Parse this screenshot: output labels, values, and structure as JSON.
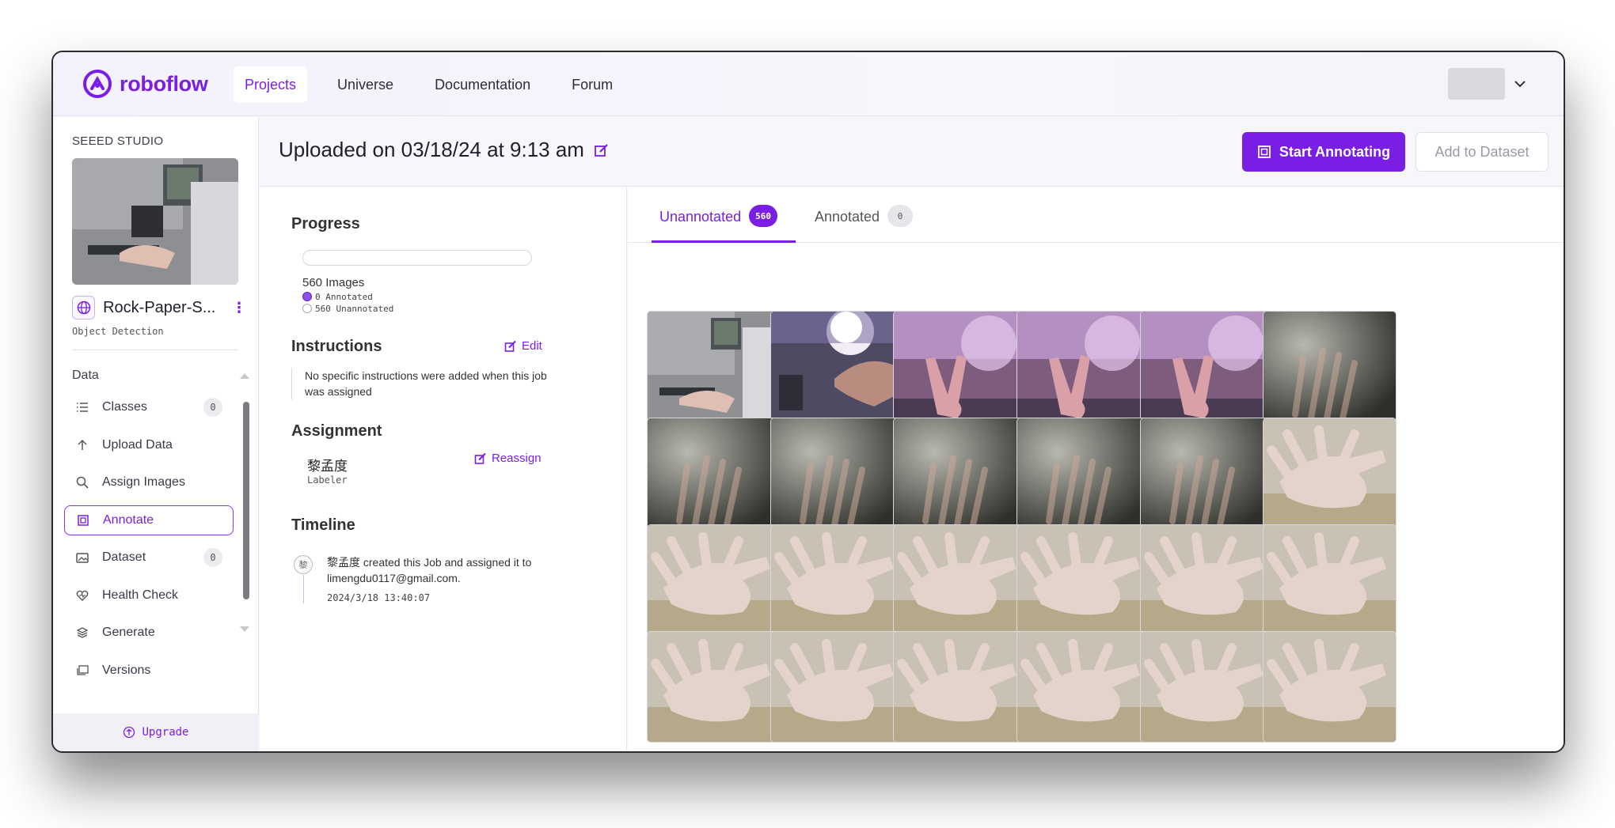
{
  "app": {
    "brand": "roboflow",
    "accent": "#7a1ee6"
  },
  "nav": {
    "items": [
      {
        "label": "Projects",
        "active": true
      },
      {
        "label": "Universe"
      },
      {
        "label": "Documentation"
      },
      {
        "label": "Forum"
      }
    ]
  },
  "sidebar": {
    "workspace": "SEEED STUDIO",
    "project_name": "Rock-Paper-S...",
    "project_type": "Object Detection",
    "section": "Data",
    "items": [
      {
        "label": "Classes",
        "icon": "list-icon",
        "badge": "0"
      },
      {
        "label": "Upload Data",
        "icon": "arrow-up-icon"
      },
      {
        "label": "Assign Images",
        "icon": "search-icon"
      },
      {
        "label": "Annotate",
        "icon": "annotate-icon",
        "active": true
      },
      {
        "label": "Dataset",
        "icon": "images-icon",
        "badge": "0"
      },
      {
        "label": "Health Check",
        "icon": "heart-icon"
      },
      {
        "label": "Generate",
        "icon": "stack-icon"
      },
      {
        "label": "Versions",
        "icon": "versions-icon"
      }
    ],
    "upgrade": "Upgrade"
  },
  "header": {
    "title": "Uploaded on 03/18/24 at 9:13 am",
    "start_button": "Start Annotating",
    "add_button": "Add to Dataset"
  },
  "panel": {
    "progress_title": "Progress",
    "progress_fraction": 0,
    "images_count": "560 Images",
    "annotated": "0 Annotated",
    "unannotated": "560 Unannotated",
    "instructions_title": "Instructions",
    "edit": "Edit",
    "instructions_text": "No specific instructions were added when this job was assigned",
    "assignment_title": "Assignment",
    "assignee": "黎孟度",
    "role": "Labeler",
    "reassign": "Reassign",
    "timeline_title": "Timeline",
    "timeline_avatar": "黎",
    "timeline_text": "黎孟度 created this Job and assigned it to limengdu0117@gmail.com.",
    "timeline_time": "2024/3/18 13:40:07"
  },
  "tabs": [
    {
      "label": "Unannotated",
      "count": "560",
      "active": true
    },
    {
      "label": "Annotated",
      "count": "0"
    }
  ],
  "grid": {
    "rows": [
      [
        "office",
        "lamp-hand",
        "pink-v",
        "pink-v",
        "pink-v",
        "dark-hand"
      ],
      [
        "dark-hand",
        "dark-hand",
        "dark-hand",
        "dark-hand",
        "dark-hand",
        "palm-light"
      ],
      [
        "palm-light",
        "palm-light",
        "palm-light",
        "palm-light",
        "palm-light",
        "palm-light"
      ],
      [
        "palm-light",
        "palm-light",
        "palm-light",
        "palm-light",
        "palm-light",
        "palm-light"
      ]
    ]
  }
}
